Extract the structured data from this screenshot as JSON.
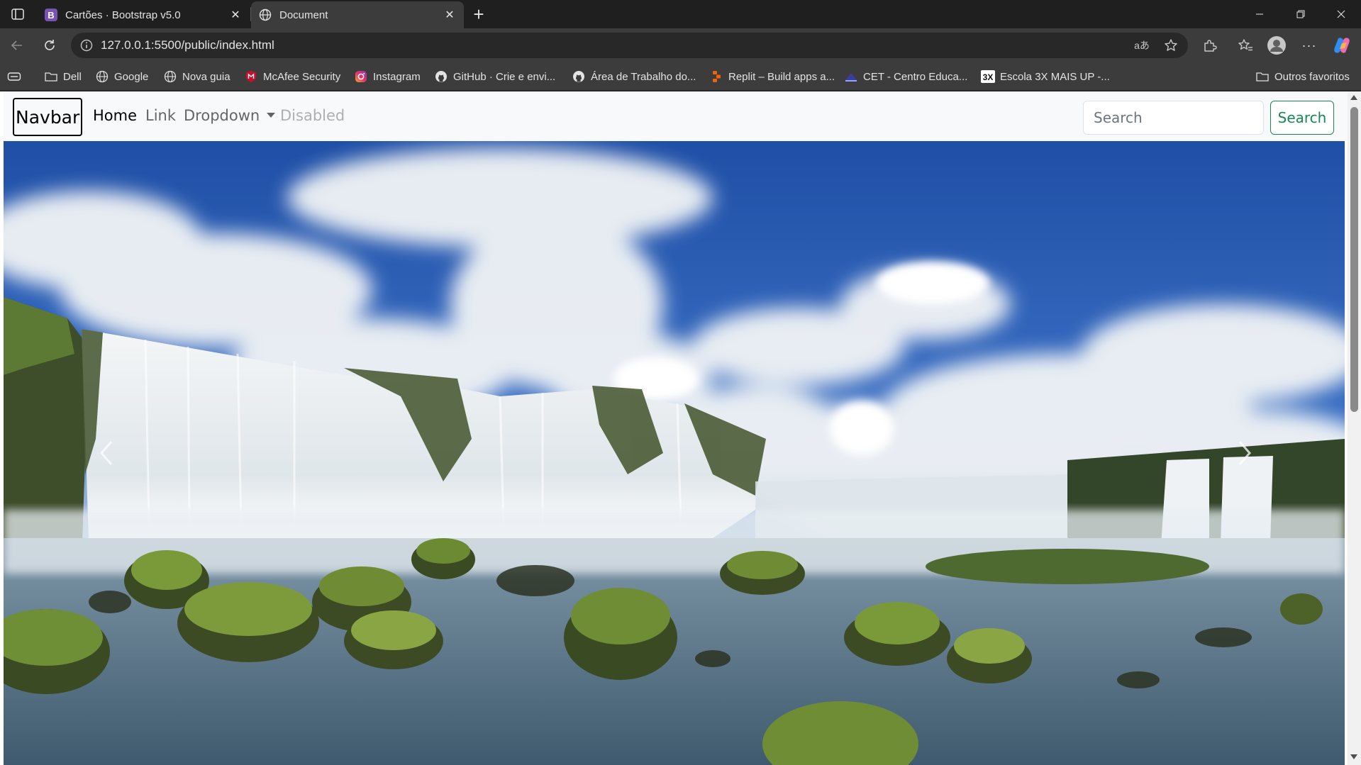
{
  "browser": {
    "tabs": [
      {
        "title": "Cartões · Bootstrap v5.0",
        "favicon": "bootstrap-icon",
        "favicon_letter": "B",
        "active": false
      },
      {
        "title": "Document",
        "favicon": "globe-icon",
        "active": true
      }
    ],
    "address": "127.0.0.1:5500/public/index.html",
    "read_aloud_label": "aあ",
    "bookmarks": [
      {
        "label": "Dell",
        "icon": "folder-icon"
      },
      {
        "label": "Google",
        "icon": "globe-icon"
      },
      {
        "label": "Nova guia",
        "icon": "globe-icon"
      },
      {
        "label": "McAfee Security",
        "icon": "mcafee-icon"
      },
      {
        "label": "Instagram",
        "icon": "instagram-icon"
      },
      {
        "label": "GitHub · Crie e envi...",
        "icon": "github-icon"
      },
      {
        "label": "Área de Trabalho do...",
        "icon": "github-icon"
      },
      {
        "label": "Replit – Build apps a...",
        "icon": "replit-icon"
      },
      {
        "label": "CET - Centro Educa...",
        "icon": "cet-icon"
      },
      {
        "label": "Escola 3X MAIS UP -...",
        "icon": "3x-icon",
        "icon_text": "3X"
      }
    ],
    "other_favorites": "Outros favoritos"
  },
  "page": {
    "navbar": {
      "brand": "Navbar",
      "links": {
        "home": "Home",
        "link": "Link",
        "dropdown": "Dropdown",
        "disabled": "Disabled"
      },
      "search_placeholder": "Search",
      "search_button": "Search"
    },
    "carousel": {
      "image": "waterfalls-landscape"
    }
  },
  "colors": {
    "browser_bg": "#1f1f1f",
    "toolbar_bg": "#3c3c3c",
    "navbar_bg": "#f8f9fa",
    "success": "#198754",
    "sky": "#2d5fb0"
  }
}
